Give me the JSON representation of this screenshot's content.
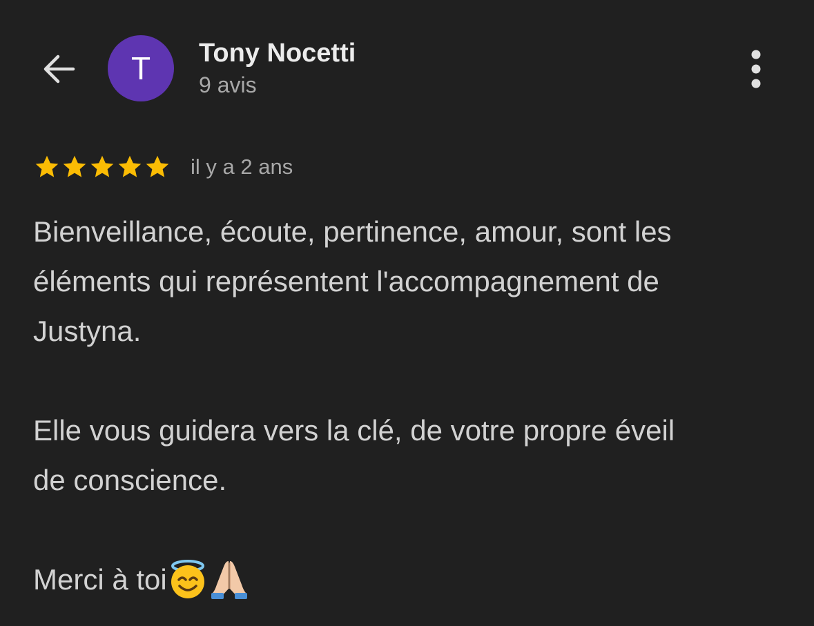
{
  "header": {
    "back_icon": "arrow-back-icon",
    "avatar_initial": "T",
    "avatar_color": "#5e35b1",
    "user_name": "Tony Nocetti",
    "review_count": "9 avis",
    "more_icon": "more-vertical-icon"
  },
  "review": {
    "rating": 5,
    "rating_max": 5,
    "star_color": "#fbbc04",
    "date": "il y a 2 ans",
    "paragraphs": {
      "p1": "Bienveillance, écoute, pertinence, amour, sont les\néléments qui représentent l'accompagnement de\nJustyna.",
      "p2": "Elle vous guidera vers la clé, de votre propre éveil\nde conscience.",
      "p3": "Merci à toi"
    },
    "emojis": [
      "smiling-face-with-halo-emoji",
      "folded-hands-emoji"
    ]
  },
  "colors": {
    "background": "#202020",
    "primary_text": "#ececec",
    "secondary_text": "#a8a8a8",
    "body_text": "#d2d2d2"
  }
}
